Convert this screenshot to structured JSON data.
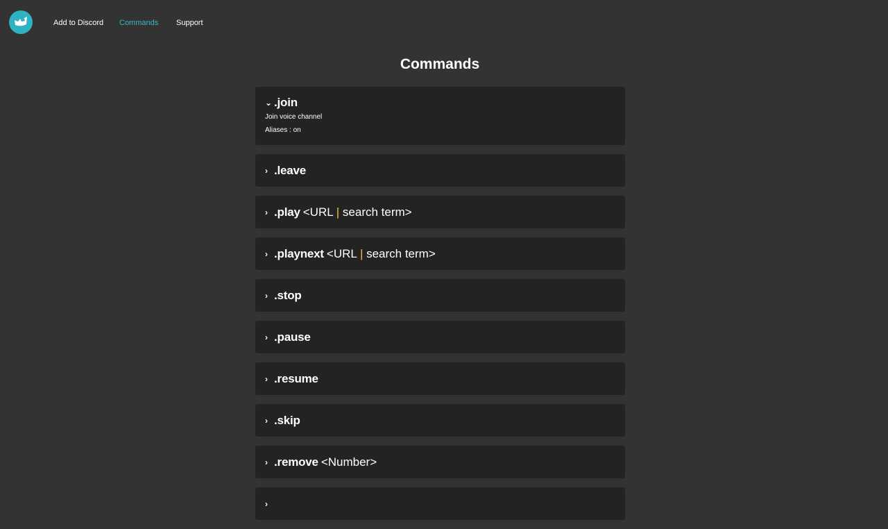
{
  "nav": {
    "logo_icon": "bot-logo-icon",
    "brand_color": "#2fb3c2",
    "links": [
      {
        "label": "Add to Discord"
      },
      {
        "label": "Commands",
        "active": true
      },
      {
        "label": "Support"
      }
    ]
  },
  "page": {
    "title": "Commands"
  },
  "commands": [
    {
      "name": ".join",
      "args": "",
      "expanded": true,
      "description": "Join voice channel",
      "aliases": "Aliases : on"
    },
    {
      "name": ".leave",
      "args": ""
    },
    {
      "name": ".play",
      "args_prefix": "<URL ",
      "args_sep": "|",
      "args_suffix": " search term>"
    },
    {
      "name": ".playnext",
      "args_prefix": "<URL ",
      "args_sep": "|",
      "args_suffix": " search term>"
    },
    {
      "name": ".stop",
      "args": ""
    },
    {
      "name": ".pause",
      "args": ""
    },
    {
      "name": ".resume",
      "args": ""
    },
    {
      "name": ".skip",
      "args": ""
    },
    {
      "name": ".remove",
      "args": "<Number>"
    },
    {
      "name": "",
      "args": ""
    }
  ]
}
